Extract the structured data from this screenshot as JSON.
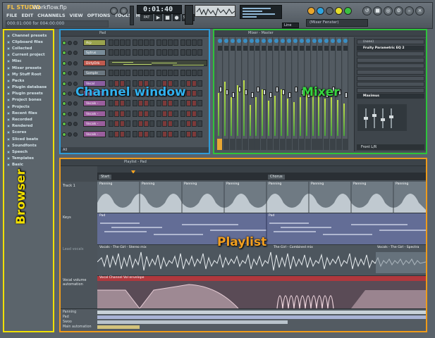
{
  "app": {
    "logo": "FL STUDIO",
    "project": "Workflow.flp",
    "time_display": "0:01:40",
    "hint": "000:01:000 for 004:00:000",
    "tempo": "",
    "line_mode": "Line",
    "preset": "(Mixer Fenster)",
    "accent_colors": {
      "browser": "#f0e000",
      "channel": "#2f9bd8",
      "mixer": "#2ec43b",
      "playlist": "#ef9b1a"
    }
  },
  "menu": [
    "FILE",
    "EDIT",
    "CHANNELS",
    "VIEW",
    "OPTIONS",
    "TOOLS",
    "HELP"
  ],
  "transport": {
    "pat": "PAT",
    "song": "SONG"
  },
  "browser": {
    "label": "Browser",
    "items": [
      "Channel presets",
      "Clipboard files",
      "Collected",
      "Current project",
      "Misc",
      "Mixer presets",
      "My Stuff Root",
      "Packs",
      "Plugin database",
      "Plugin presets",
      "Project bones",
      "Projects",
      "Recent files",
      "Recorded",
      "Rendered",
      "Scores",
      "Sliced beats",
      "Soundfonts",
      "Speech",
      "Templates",
      "Basic"
    ]
  },
  "channel_window": {
    "label": "Channel window",
    "title": "Pad",
    "footer": "All",
    "channels": [
      {
        "name": "Arp",
        "color": "#9aa34e"
      },
      {
        "name": "Sytrus",
        "color": "#7a8d9a"
      },
      {
        "name": "DirtyOrb",
        "color": "#c05a4f"
      },
      {
        "name": "Sample Pitch",
        "color": "#6b7780"
      },
      {
        "name": "Vocal Channel",
        "color": "#8a5da0"
      },
      {
        "name": "Vocals - The",
        "color": "#9b5e9e"
      },
      {
        "name": "Vocals - The G",
        "color": "#9b5e9e"
      },
      {
        "name": "Vocals - The G",
        "color": "#9b5e9e"
      },
      {
        "name": "Vocals - The",
        "color": "#9b5e9e"
      },
      {
        "name": "Vocals - The G",
        "color": "#9b5e9e"
      }
    ]
  },
  "mixer": {
    "label": "Mixer",
    "title": "Mixer - Master",
    "fx": [
      "(none)",
      "Fruity Parametric EQ 2",
      "",
      "",
      "",
      "",
      "",
      "",
      "",
      "Maximus"
    ],
    "output": "Front L/R",
    "level_label": "Master",
    "strip_levels": [
      0.55,
      0.7,
      0.5,
      0.65,
      0.72,
      0.4,
      0.5,
      0.6,
      0.45,
      0.52,
      0.6,
      0.48,
      0.44,
      0.5,
      0.56,
      0.6,
      0.52,
      0.48,
      0.5,
      0.46,
      0.42
    ]
  },
  "playlist": {
    "label": "Playlist",
    "title": "Playlist - Pad",
    "markers": [
      "Start",
      "Chorus"
    ],
    "tracks": [
      {
        "name": "Track 1",
        "clip": "Panning"
      },
      {
        "name": "Keys",
        "clip": "Pad"
      },
      {
        "name": "Lead vocals",
        "clip": "Vocals - The Girl - Stereo mix"
      },
      {
        "name": "Vocal volume automation",
        "clip": "Vocal Channel Vol envelope"
      }
    ],
    "vocal_clips": [
      "Vocals - The Girl - Stereo mix",
      "The Girl - Combined mix",
      "Vocals - The Girl - Spectra"
    ],
    "bottom_rows": [
      "Panning",
      "Pad",
      "Swoo",
      "Main automation"
    ]
  }
}
